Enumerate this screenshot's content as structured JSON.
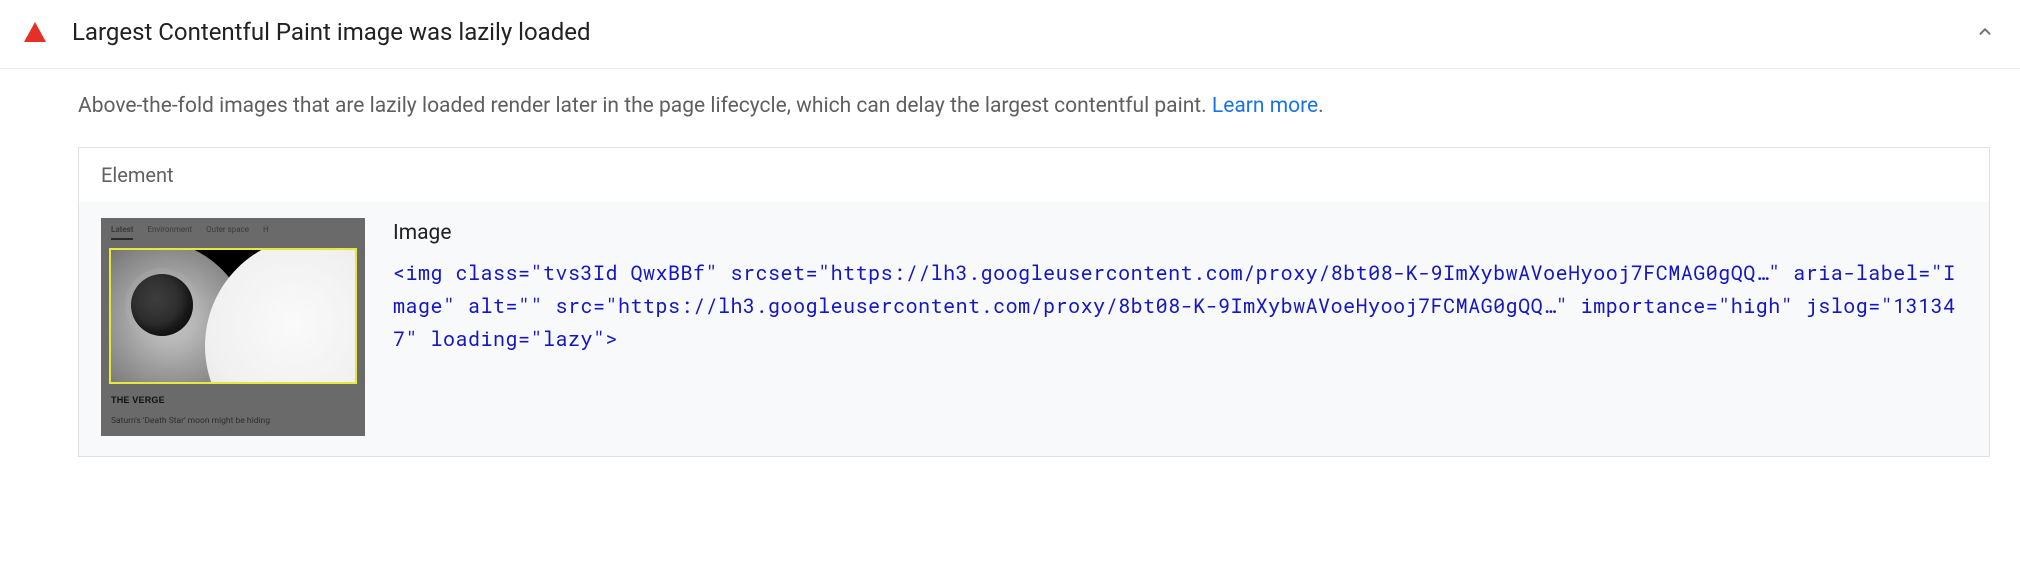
{
  "audit": {
    "title": "Largest Contentful Paint image was lazily loaded",
    "description_prefix": "Above-the-fold images that are lazily loaded render later in the page lifecycle, which can delay the largest contentful paint. ",
    "learn_more": "Learn more",
    "description_suffix": "."
  },
  "table": {
    "header": "Element",
    "row": {
      "label": "Image",
      "code": "<img class=\"tvs3Id QwxBBf\" srcset=\"https://lh3.googleusercontent.com/proxy/8bt08-K-9ImXybwAVoeHyooj7FCMAG0gQQ…\" aria-label=\"Image\" alt=\"\" src=\"https://lh3.googleusercontent.com/proxy/8bt08-K-9ImXybwAVoeHyooj7FCMAG0gQQ…\" importance=\"high\" jslog=\"131347\" loading=\"lazy\">",
      "thumb": {
        "tabs": [
          "Latest",
          "Environment",
          "Outer space",
          "H"
        ],
        "source": "THE VERGE",
        "caption": "Saturn's 'Death Star' moon might be hiding"
      }
    }
  }
}
